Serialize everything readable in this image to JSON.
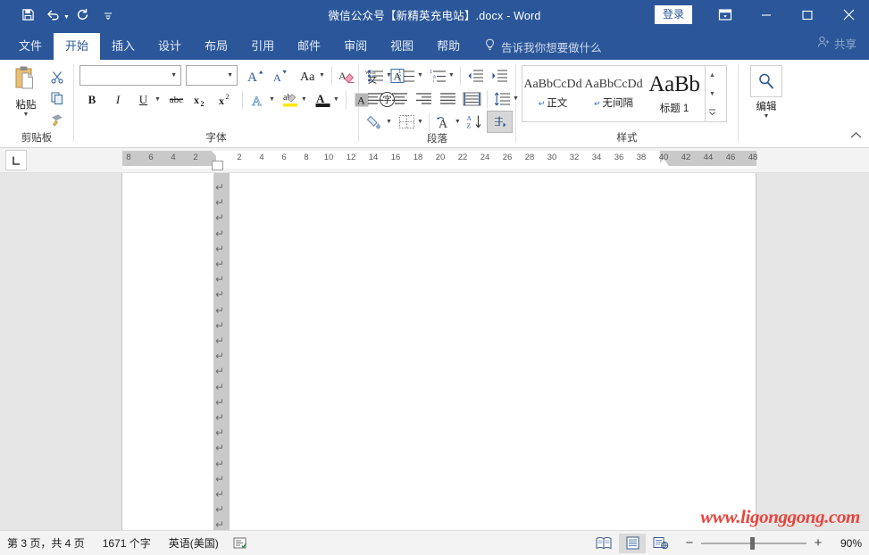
{
  "titlebar": {
    "document_title": "微信公众号【新精英充电站】.docx  -  Word",
    "signin_label": "登录",
    "qat": [
      {
        "name": "save",
        "icon": "save-icon"
      },
      {
        "name": "undo",
        "icon": "undo-icon"
      },
      {
        "name": "redo",
        "icon": "redo-icon"
      },
      {
        "name": "customize-qat",
        "icon": "chevron-down-icon"
      }
    ],
    "window_controls": {
      "ribbon_display": "ribbon-display-options-icon",
      "minimize": "minimize-icon",
      "maximize": "maximize-icon",
      "close": "close-icon"
    }
  },
  "tabs": [
    {
      "label": "文件",
      "name": "file",
      "active": false
    },
    {
      "label": "开始",
      "name": "home",
      "active": true
    },
    {
      "label": "插入",
      "name": "insert",
      "active": false
    },
    {
      "label": "设计",
      "name": "design",
      "active": false
    },
    {
      "label": "布局",
      "name": "layout",
      "active": false
    },
    {
      "label": "引用",
      "name": "references",
      "active": false
    },
    {
      "label": "邮件",
      "name": "mailings",
      "active": false
    },
    {
      "label": "审阅",
      "name": "review",
      "active": false
    },
    {
      "label": "视图",
      "name": "view",
      "active": false
    },
    {
      "label": "帮助",
      "name": "help",
      "active": false
    }
  ],
  "tellme": {
    "label": "告诉我你想要做什么",
    "icon": "lightbulb-icon"
  },
  "share": {
    "label": "共享",
    "icon": "share-person-icon"
  },
  "ribbon": {
    "clipboard": {
      "group_label": "剪贴板",
      "paste_label": "粘贴",
      "buttons": [
        {
          "name": "cut",
          "icon": "scissors-icon"
        },
        {
          "name": "copy",
          "icon": "copy-icon"
        },
        {
          "name": "format-painter",
          "icon": "format-painter-icon"
        }
      ]
    },
    "font": {
      "group_label": "字体",
      "font_name_value": "",
      "font_size_value": "",
      "buttons": [
        {
          "name": "grow-font",
          "label": "A"
        },
        {
          "name": "shrink-font",
          "label": "A"
        },
        {
          "name": "change-case",
          "label": "Aa"
        },
        {
          "name": "clear-formatting",
          "icon": "clear-format-icon"
        },
        {
          "name": "phonetic-guide",
          "label": "wén 文"
        },
        {
          "name": "character-border",
          "label": "A"
        },
        {
          "name": "bold",
          "label": "B"
        },
        {
          "name": "italic",
          "label": "I"
        },
        {
          "name": "underline",
          "label": "U"
        },
        {
          "name": "strikethrough",
          "label": "abc"
        },
        {
          "name": "subscript",
          "label": "x₂"
        },
        {
          "name": "superscript",
          "label": "x²"
        },
        {
          "name": "text-effects",
          "label": "A"
        },
        {
          "name": "text-highlight-color",
          "label": "ab"
        },
        {
          "name": "font-color",
          "label": "A"
        },
        {
          "name": "character-shading",
          "label": "A"
        },
        {
          "name": "enclose-characters",
          "label": "字"
        }
      ]
    },
    "paragraph": {
      "group_label": "段落",
      "buttons": [
        {
          "name": "bullets",
          "icon": "bullet-list-icon"
        },
        {
          "name": "numbering",
          "icon": "numbered-list-icon"
        },
        {
          "name": "multilevel-list",
          "icon": "multilevel-list-icon"
        },
        {
          "name": "decrease-indent",
          "icon": "decrease-indent-icon"
        },
        {
          "name": "increase-indent",
          "icon": "increase-indent-icon"
        },
        {
          "name": "align-left",
          "icon": "align-left-icon"
        },
        {
          "name": "align-center",
          "icon": "align-center-icon"
        },
        {
          "name": "align-right",
          "icon": "align-right-icon"
        },
        {
          "name": "justify",
          "icon": "justify-icon"
        },
        {
          "name": "distribute",
          "icon": "distribute-icon"
        },
        {
          "name": "line-spacing",
          "icon": "line-spacing-icon"
        },
        {
          "name": "shading",
          "icon": "shading-icon"
        },
        {
          "name": "borders",
          "icon": "borders-icon"
        },
        {
          "name": "text-effects-para",
          "icon": "asian-layout-icon"
        },
        {
          "name": "sort",
          "icon": "sort-az-icon"
        },
        {
          "name": "show-formatting-marks",
          "icon": "pilcrow-icon"
        }
      ],
      "show_marks_active": true
    },
    "styles": {
      "group_label": "样式",
      "items": [
        {
          "preview": "AaBbCcDd",
          "name": "正文",
          "kind": "normal",
          "mark": "↵"
        },
        {
          "preview": "AaBbCcDd",
          "name": "无间隔",
          "kind": "normal",
          "mark": "↵"
        },
        {
          "preview": "AaBb",
          "name": "标题 1",
          "kind": "h1",
          "mark": ""
        }
      ]
    },
    "editing": {
      "group_label": "编辑",
      "icon": "search-icon"
    },
    "collapse_icon": "chevron-up-icon"
  },
  "ruler": {
    "tab_selector_icon": "left-tab-stop-icon",
    "ticks": [
      8,
      6,
      4,
      2,
      2,
      4,
      6,
      8,
      10,
      12,
      14,
      16,
      18,
      20,
      22,
      24,
      26,
      28,
      30,
      32,
      34,
      36,
      38,
      40,
      42,
      44,
      46,
      48
    ]
  },
  "document": {
    "paragraph_mark": "↵",
    "paragraph_mark_count": 23,
    "watermark_text": "www.ligonggong.com",
    "watermark_color": "#e8453c"
  },
  "statusbar": {
    "page_info": "第 3 页，共 4 页",
    "word_count": "1671 个字",
    "language": "英语(美国)",
    "proofing_icon": "proofing-errors-icon",
    "views": [
      {
        "name": "read-mode",
        "icon": "read-mode-icon",
        "active": false
      },
      {
        "name": "print-layout",
        "icon": "print-layout-icon",
        "active": true
      },
      {
        "name": "web-layout",
        "icon": "web-layout-icon",
        "active": false
      }
    ],
    "zoom_out": "−",
    "zoom_in": "+",
    "zoom_value": "90%"
  },
  "colors": {
    "brand_blue": "#2b579a",
    "ribbon_bg": "#ffffff",
    "doc_bg": "#e6e6e6",
    "status_bg": "#f3f3f3"
  }
}
